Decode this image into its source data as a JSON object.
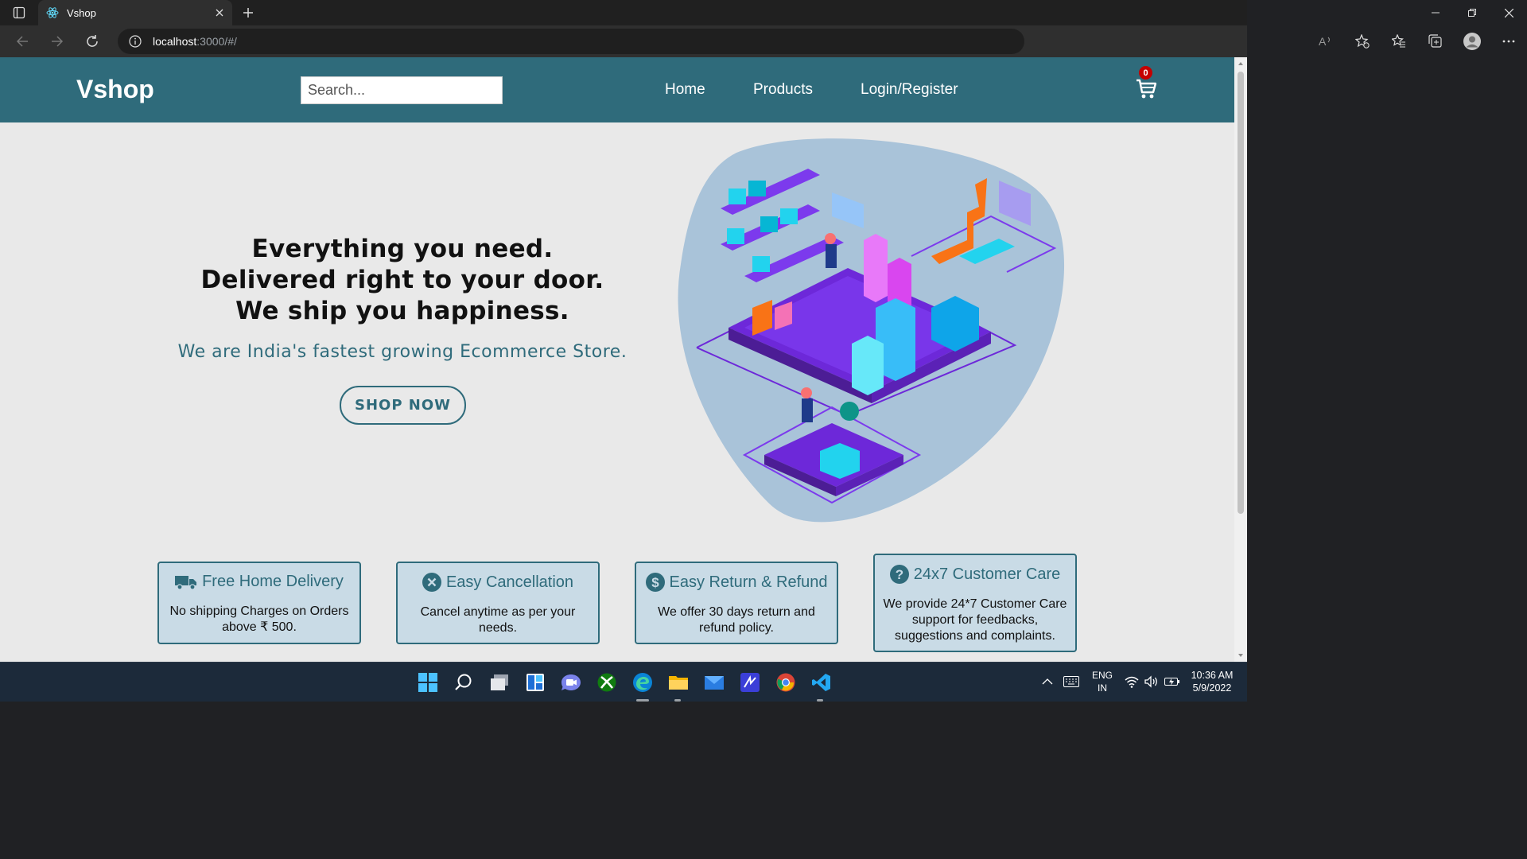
{
  "browser": {
    "tab_title": "Vshop",
    "url_host": "localhost",
    "url_path": ":3000/#/"
  },
  "site": {
    "logo": "Vshop",
    "search_placeholder": "Search...",
    "nav": [
      "Home",
      "Products",
      "Login/Register"
    ],
    "cart_count": "0"
  },
  "hero": {
    "title": "Everything you need. Delivered right to your door. We ship you happiness.",
    "subtitle": "We are India's fastest growing Ecommerce Store.",
    "cta": "SHOP NOW"
  },
  "features": [
    {
      "icon": "truck-icon",
      "title": "Free Home Delivery",
      "desc": "No shipping Charges on Orders above ₹ 500."
    },
    {
      "icon": "x-circle-icon",
      "title": "Easy Cancellation",
      "desc": "Cancel anytime as per your needs."
    },
    {
      "icon": "dollar-circle-icon",
      "title": "Easy Return & Refund",
      "desc": "We offer 30 days return and refund policy."
    },
    {
      "icon": "question-circle-icon",
      "title": "24x7 Customer Care",
      "desc": "We provide 24*7 Customer Care support for feedbacks, suggestions and complaints."
    }
  ],
  "taskbar": {
    "lang": "ENG",
    "region": "IN",
    "time": "10:36 AM",
    "date": "5/9/2022"
  },
  "colors": {
    "brand": "#2f6b7b",
    "page_bg": "#e9e9e9",
    "card_bg": "#c9dbe6",
    "badge": "#c50000"
  }
}
